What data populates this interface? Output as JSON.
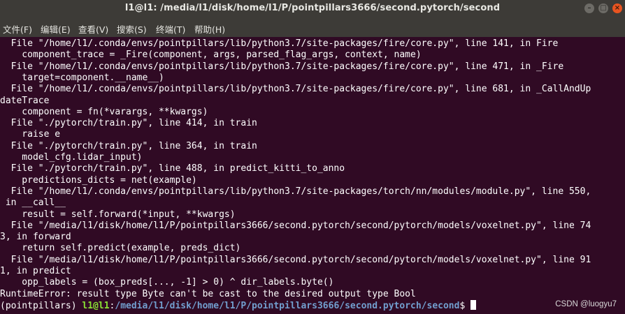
{
  "window": {
    "title": "l1@l1: /media/l1/disk/home/l1/P/pointpillars3666/second.pytorch/second",
    "controls": {
      "minimize": "–",
      "maximize": "□",
      "close": "×"
    }
  },
  "menu": [
    "文件(F)",
    "编辑(E)",
    "查看(V)",
    "搜索(S)",
    "终端(T)",
    "帮助(H)"
  ],
  "terminal": {
    "lines": [
      "  File \"/home/l1/.conda/envs/pointpillars/lib/python3.7/site-packages/fire/core.py\", line 141, in Fire",
      "    component_trace = _Fire(component, args, parsed_flag_args, context, name)",
      "  File \"/home/l1/.conda/envs/pointpillars/lib/python3.7/site-packages/fire/core.py\", line 471, in _Fire",
      "    target=component.__name__)",
      "  File \"/home/l1/.conda/envs/pointpillars/lib/python3.7/site-packages/fire/core.py\", line 681, in _CallAndUp",
      "dateTrace",
      "    component = fn(*varargs, **kwargs)",
      "  File \"./pytorch/train.py\", line 414, in train",
      "    raise e",
      "  File \"./pytorch/train.py\", line 364, in train",
      "    model_cfg.lidar_input)",
      "  File \"./pytorch/train.py\", line 488, in predict_kitti_to_anno",
      "    predictions_dicts = net(example)",
      "  File \"/home/l1/.conda/envs/pointpillars/lib/python3.7/site-packages/torch/nn/modules/module.py\", line 550,",
      " in __call__",
      "    result = self.forward(*input, **kwargs)",
      "  File \"/media/l1/disk/home/l1/P/pointpillars3666/second.pytorch/second/pytorch/models/voxelnet.py\", line 74",
      "3, in forward",
      "    return self.predict(example, preds_dict)",
      "  File \"/media/l1/disk/home/l1/P/pointpillars3666/second.pytorch/second/pytorch/models/voxelnet.py\", line 91",
      "1, in predict",
      "    opp_labels = (box_preds[..., -1] > 0) ^ dir_labels.byte()",
      "RuntimeError: result type Byte can't be cast to the desired output type Bool"
    ],
    "prompt": {
      "env": "(pointpillars) ",
      "user_host": "l1@l1",
      "sep": ":",
      "path": "/media/l1/disk/home/l1/P/pointpillars3666/second.pytorch/second",
      "symbol": "$ "
    }
  },
  "watermark": "CSDN @luogyu7"
}
